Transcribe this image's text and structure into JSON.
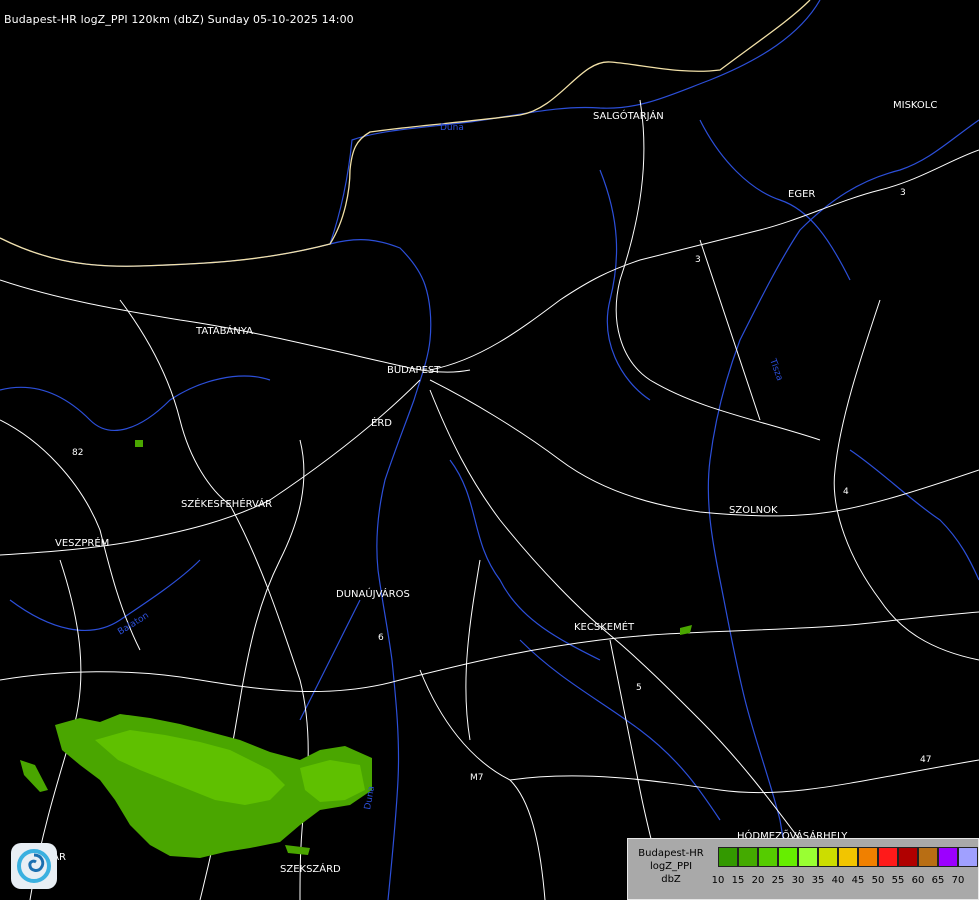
{
  "title": "Budapest-HR logZ_PPI 120km (dbZ) Sunday 05-10-2025 14:00",
  "cities": [
    {
      "id": "salgotarjan",
      "label": "SALGÓTARJÁN"
    },
    {
      "id": "eger",
      "label": "EGER"
    },
    {
      "id": "tatabanya",
      "label": "TATABÁNYA"
    },
    {
      "id": "budapest",
      "label": "BUDAPEST"
    },
    {
      "id": "erd",
      "label": "ÉRD"
    },
    {
      "id": "szekesfehervar",
      "label": "SZÉKESFEHÉRVÁR"
    },
    {
      "id": "veszprem",
      "label": "VESZPRÉM"
    },
    {
      "id": "szolnok",
      "label": "SZOLNOK"
    },
    {
      "id": "dunaujvaros",
      "label": "DUNAÚJVÁROS"
    },
    {
      "id": "kecskemet",
      "label": "KECSKEMÉT"
    },
    {
      "id": "hodmezovasarhely",
      "label": "HÓDMEZŐVÁSÁRHELY"
    },
    {
      "id": "szekszard",
      "label": "SZEKSZÁRD"
    },
    {
      "id": "miskolc",
      "label": "MISKOLC"
    },
    {
      "id": "kaposvar",
      "label": "VÁR"
    }
  ],
  "road_labels": [
    "82",
    "3",
    "3",
    "4",
    "M7",
    "47",
    "6",
    "5",
    "Balaton",
    "Duna",
    "Duna",
    "Tisza"
  ],
  "legend": {
    "line1": "Budapest-HR",
    "line2": "logZ_PPI",
    "line3": "dbZ",
    "ticks": [
      "10",
      "15",
      "20",
      "25",
      "30",
      "35",
      "40",
      "45",
      "50",
      "55",
      "60",
      "65",
      "70"
    ],
    "colors": [
      "#339900",
      "#44aa00",
      "#55cc00",
      "#66ee00",
      "#99ff33",
      "#ccdd00",
      "#f2c500",
      "#f08000",
      "#ff1a1a",
      "#b00000",
      "#b86e14",
      "#9c00ff",
      "#a0a0ff"
    ]
  },
  "colors": {
    "borders": "#ffffff",
    "rivers": "#2c4fd9",
    "country_border": "#f2e1a8",
    "echo_weak": "#4aa600",
    "echo_mid": "#5fc000"
  }
}
